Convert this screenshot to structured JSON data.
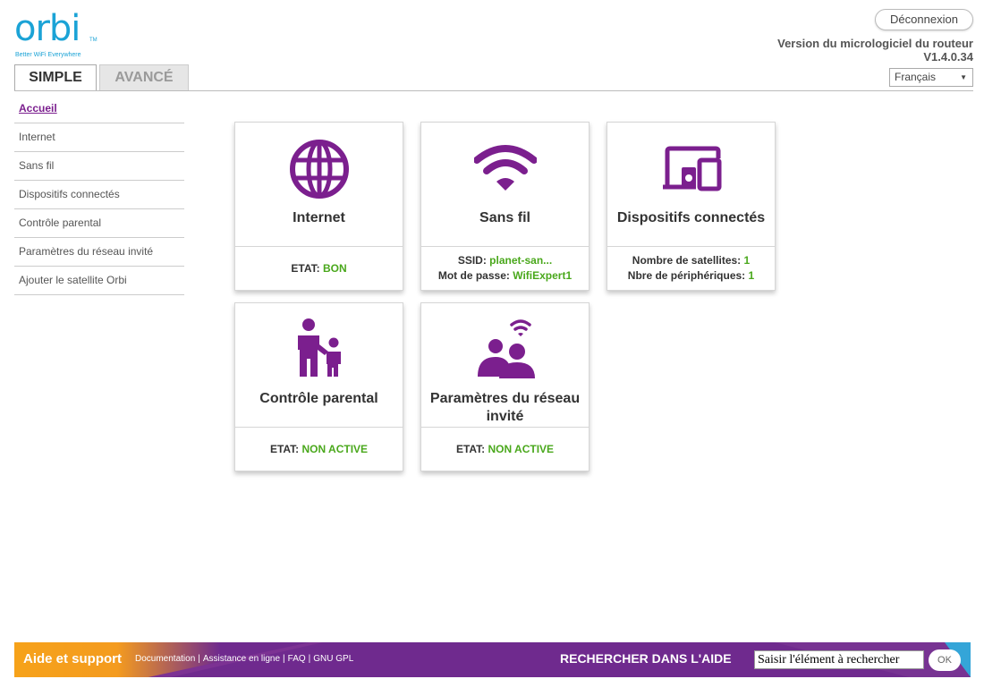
{
  "brand": {
    "logo_text": "orbi",
    "trademark": "TM",
    "tagline": "Better WiFi Everywhere",
    "color": "#1ba3d6"
  },
  "header": {
    "logout_label": "Déconnexion",
    "firmware_label": "Version du micrologiciel du routeur",
    "firmware_version": "V1.4.0.34",
    "language_selected": "Français"
  },
  "tabs": [
    {
      "label": "SIMPLE",
      "active": true
    },
    {
      "label": "AVANCÉ",
      "active": false
    }
  ],
  "sidebar": {
    "items": [
      {
        "label": "Accueil",
        "active": true
      },
      {
        "label": "Internet"
      },
      {
        "label": "Sans fil"
      },
      {
        "label": "Dispositifs connectés"
      },
      {
        "label": "Contrôle parental"
      },
      {
        "label": "Paramètres du réseau invité"
      },
      {
        "label": "Ajouter le satellite Orbi"
      }
    ]
  },
  "cards": {
    "internet": {
      "icon": "globe-icon",
      "title": "Internet",
      "status_label": "ETAT:",
      "status_value": "BON"
    },
    "wireless": {
      "icon": "wifi-icon",
      "title": "Sans fil",
      "ssid_label": "SSID:",
      "ssid_value": "planet-san...",
      "password_label": "Mot de passe:",
      "password_value": "WifiExpert1"
    },
    "devices": {
      "icon": "devices-icon",
      "title": "Dispositifs connectés",
      "satellites_label": "Nombre de satellites:",
      "satellites_value": "1",
      "devices_label": "Nbre de périphériques:",
      "devices_value": "1"
    },
    "parental": {
      "icon": "parent-child-icon",
      "title": "Contrôle parental",
      "status_label": "ETAT:",
      "status_value": "NON ACTIVE"
    },
    "guest": {
      "icon": "guest-network-icon",
      "title_line1": "Paramètres du réseau",
      "title_line2": "invité",
      "status_label": "ETAT:",
      "status_value": "NON ACTIVE"
    }
  },
  "footer": {
    "help_label": "Aide et support",
    "links": [
      "Documentation",
      "Assistance en ligne",
      "FAQ",
      "GNU GPL"
    ],
    "search_label": "RECHERCHER DANS L'AIDE",
    "search_value": "Saisir l'élément à rechercher",
    "ok_label": "OK"
  },
  "colors": {
    "accent_purple": "#7b1f8e",
    "status_green": "#4aa81c",
    "footer_orange": "#f6a21a",
    "footer_purple": "#6f2a8e"
  }
}
